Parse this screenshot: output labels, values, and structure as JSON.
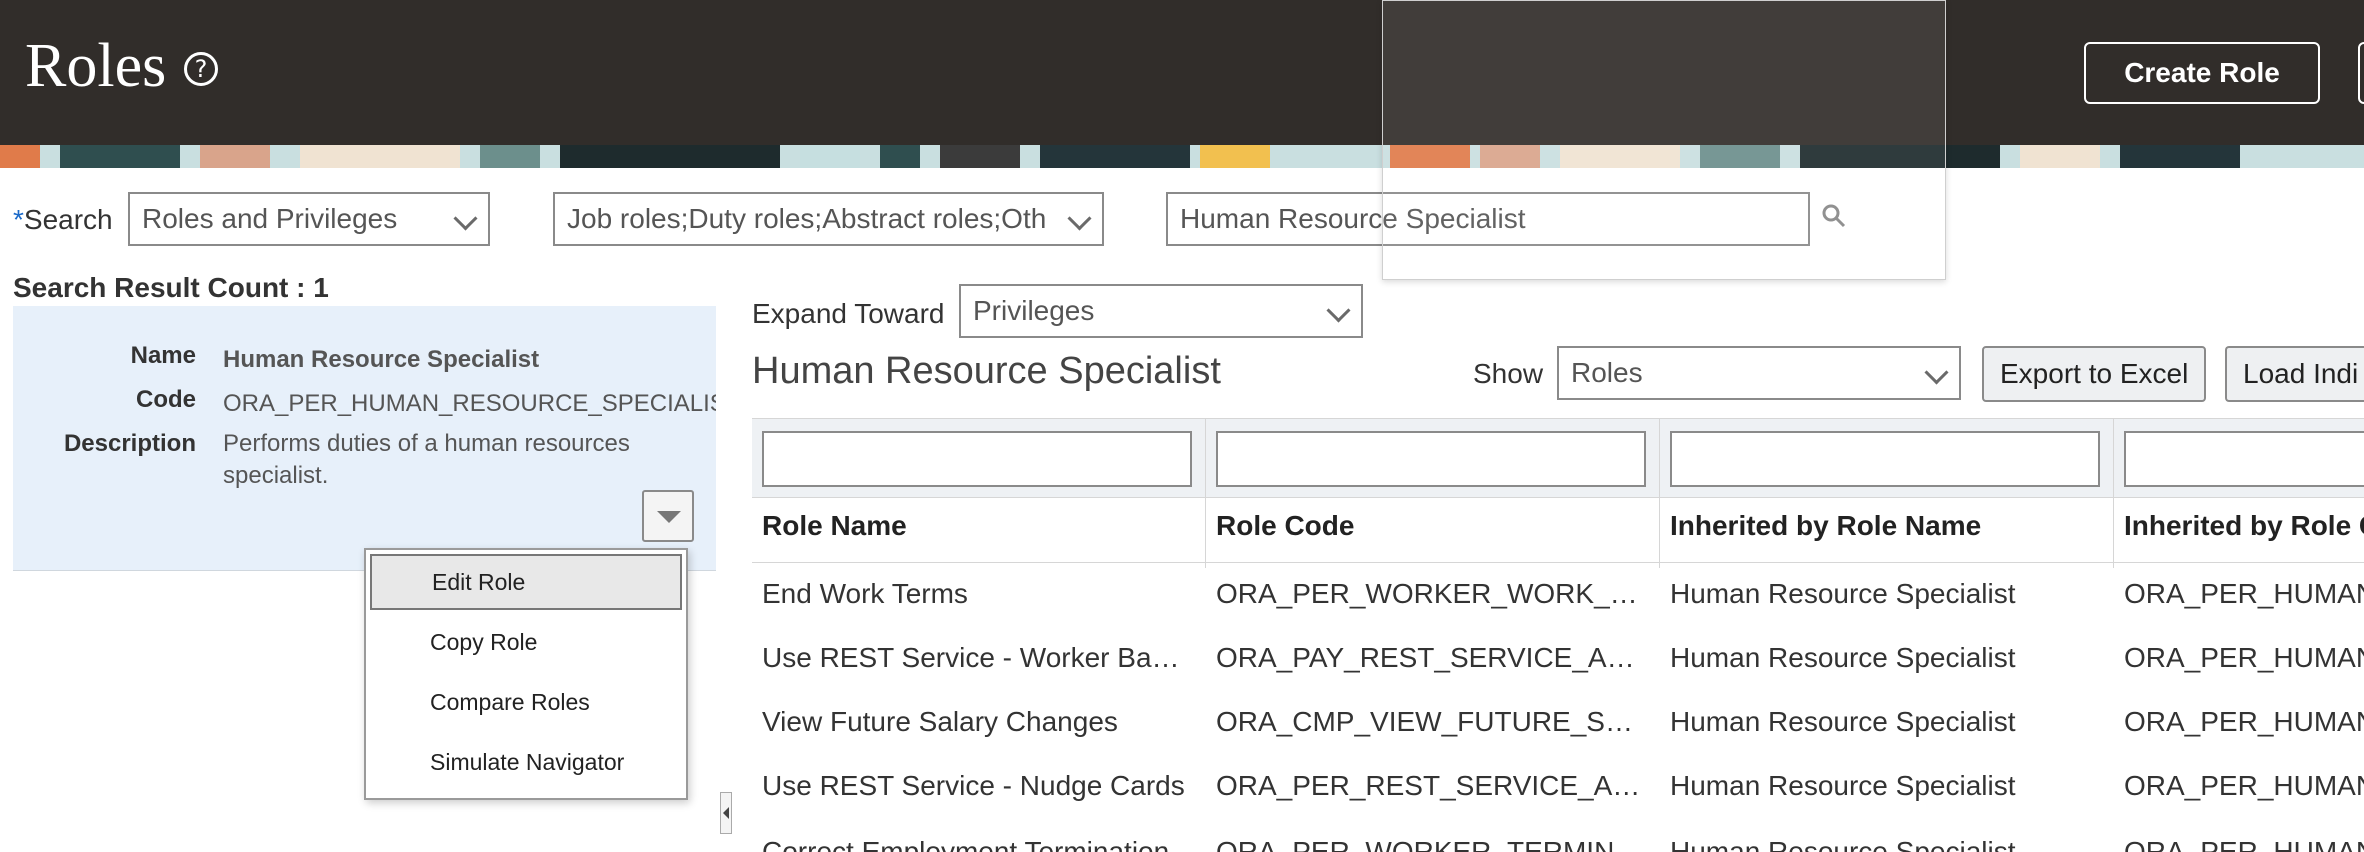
{
  "header": {
    "title": "Roles",
    "help_icon": "help-circle-icon",
    "create_role_label": "Create Role"
  },
  "search": {
    "label": "Search",
    "required_marker": "*",
    "type_value": "Roles and Privileges",
    "role_types_value": "Job roles;Duty roles;Abstract roles;Oth",
    "query_value": "Human Resource Specialist"
  },
  "results": {
    "count_label": "Search Result Count : 1"
  },
  "details": {
    "name_label": "Name",
    "name_value": "Human Resource Specialist",
    "code_label": "Code",
    "code_value": "ORA_PER_HUMAN_RESOURCE_SPECIALIST_JO",
    "description_label": "Description",
    "description_value_line1": "Performs duties of a human resources",
    "description_value_line2": "specialist."
  },
  "menu": {
    "items": [
      "Edit Role",
      "Copy Role",
      "Compare Roles",
      "Simulate Navigator"
    ]
  },
  "explorer": {
    "expand_label": "Expand Toward",
    "expand_value": "Privileges",
    "role_title": "Human Resource Specialist",
    "show_label": "Show",
    "show_value": "Roles",
    "export_label": "Export to Excel",
    "load_label": "Load Indi"
  },
  "table": {
    "columns": [
      "Role Name",
      "Role Code",
      "Inherited by Role Name",
      "Inherited by Role C"
    ],
    "rows": [
      [
        "End Work Terms",
        "ORA_PER_WORKER_WORK_…",
        "Human Resource Specialist",
        "ORA_PER_HUMAN"
      ],
      [
        "Use REST Service - Worker Ba…",
        "ORA_PAY_REST_SERVICE_A…",
        "Human Resource Specialist",
        "ORA_PER_HUMAN"
      ],
      [
        "View Future Salary Changes",
        "ORA_CMP_VIEW_FUTURE_S…",
        "Human Resource Specialist",
        "ORA_PER_HUMAN"
      ],
      [
        "Use REST Service - Nudge Cards",
        "ORA_PER_REST_SERVICE_A…",
        "Human Resource Specialist",
        "ORA_PER_HUMAN"
      ],
      [
        "Correct Employment Termination",
        "ORA_PER_WORKER_TERMIN…",
        "Human Resource Specialist",
        "ORA_PER_HUMAN"
      ]
    ]
  },
  "colors": {
    "header_bg": "#312d2a",
    "card_bg": "#e7f0fa",
    "required_marker": "#1b6ac9"
  }
}
